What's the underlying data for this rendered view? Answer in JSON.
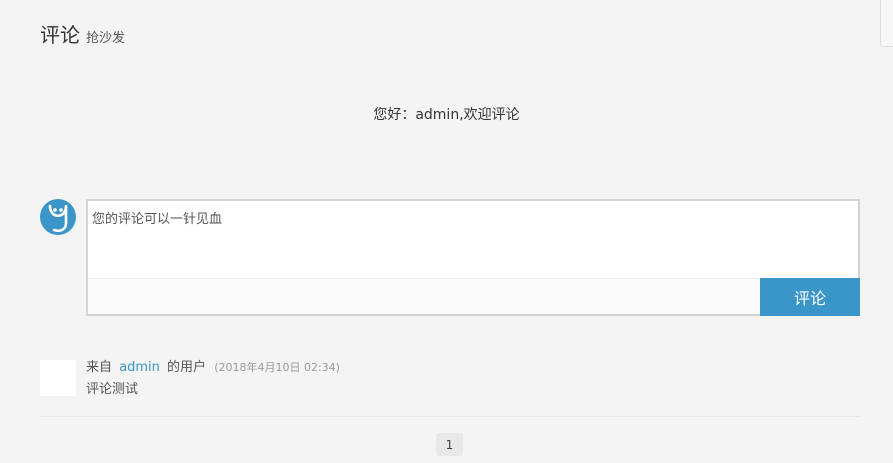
{
  "header": {
    "title": "评论",
    "subtitle": "抢沙发"
  },
  "greeting": "您好：admin,欢迎评论",
  "comment_form": {
    "avatar_icon": "user-logo-icon",
    "placeholder": "您的评论可以一针见血",
    "submit_label": "评论",
    "accent_color": "#3a96c9"
  },
  "comments": [
    {
      "prefix": "来自",
      "author": "admin",
      "suffix": "的用户",
      "date": "(2018年4月10日 02:34)",
      "content": "评论测试"
    }
  ],
  "pagination": {
    "current_page": "1"
  }
}
